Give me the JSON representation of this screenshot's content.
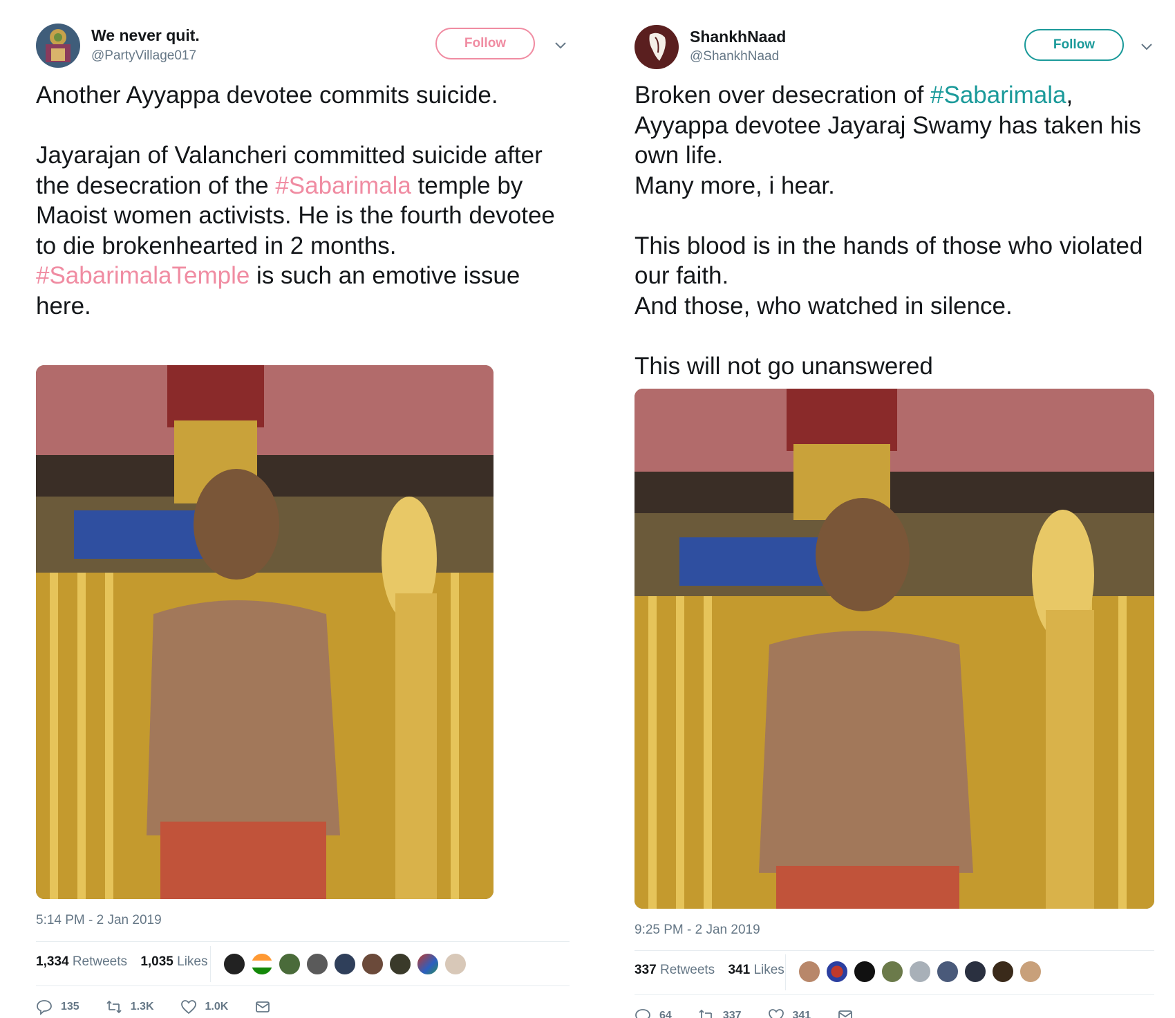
{
  "tweets": [
    {
      "name": "We never quit.",
      "handle": "@PartyVillage017",
      "follow_label": "Follow",
      "accent": "#f08ca2",
      "body_parts": [
        {
          "text": "Another Ayyappa devotee commits suicide.\n\nJayarajan of Valancheri committed suicide after the desecration of the ",
          "hashtag": false
        },
        {
          "text": "#Sabarimala",
          "hashtag": true
        },
        {
          "text": " temple by Maoist women activists. He is the fourth devotee to die brokenhearted in 2 months.\n",
          "hashtag": false
        },
        {
          "text": "#SabarimalaTemple",
          "hashtag": true
        },
        {
          "text": " is such an emotive issue here.",
          "hashtag": false
        }
      ],
      "timestamp": "5:14 PM - 2 Jan 2019",
      "retweets_count": "1,334",
      "retweets_label": "Retweets",
      "likes_count": "1,035",
      "likes_label": "Likes",
      "reply_count": "135",
      "retweet_action_count": "1.3K",
      "like_action_count": "1.0K"
    },
    {
      "name": "ShankhNaad",
      "handle": "@ShankhNaad",
      "follow_label": "Follow",
      "accent": "#1b9a9a",
      "body_parts": [
        {
          "text": "Broken over desecration of ",
          "hashtag": false
        },
        {
          "text": "#Sabarimala",
          "hashtag": true
        },
        {
          "text": ",\nAyyappa devotee Jayaraj Swamy has taken his own life.\nMany more, i hear.\n\nThis blood is in the hands of those who violated our faith.\nAnd those, who watched in silence.\n\nThis will not go unanswered",
          "hashtag": false
        }
      ],
      "timestamp": "9:25 PM - 2 Jan 2019",
      "retweets_count": "337",
      "retweets_label": "Retweets",
      "likes_count": "341",
      "likes_label": "Likes",
      "reply_count": "64",
      "retweet_action_count": "337",
      "like_action_count": "341"
    }
  ],
  "colors": {
    "text": "#14171a",
    "secondary": "#657786",
    "divider": "#e6ecf0"
  }
}
